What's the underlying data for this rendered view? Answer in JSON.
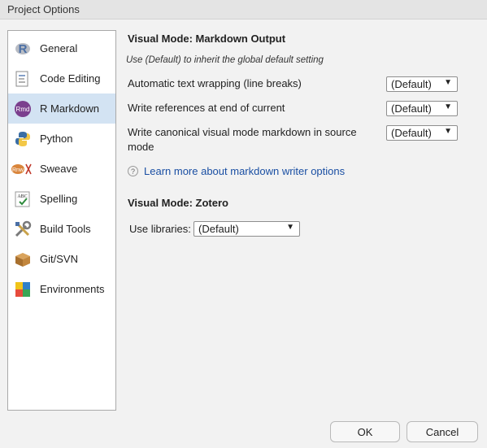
{
  "window": {
    "title": "Project Options"
  },
  "sidebar": {
    "items": [
      {
        "label": "General",
        "icon": "r-logo-icon"
      },
      {
        "label": "Code Editing",
        "icon": "code-editing-icon"
      },
      {
        "label": "R Markdown",
        "icon": "rmd-icon",
        "selected": true
      },
      {
        "label": "Python",
        "icon": "python-icon"
      },
      {
        "label": "Sweave",
        "icon": "sweave-icon"
      },
      {
        "label": "Spelling",
        "icon": "spelling-icon"
      },
      {
        "label": "Build Tools",
        "icon": "build-tools-icon"
      },
      {
        "label": "Git/SVN",
        "icon": "git-svn-icon"
      },
      {
        "label": "Environments",
        "icon": "environments-icon"
      }
    ]
  },
  "main": {
    "markdown_output_heading": "Visual Mode: Markdown Output",
    "inherit_note": "Use (Default) to inherit the global default setting",
    "options": [
      {
        "label": "Automatic text wrapping (line breaks)",
        "value": "(Default)"
      },
      {
        "label": "Write references at end of current",
        "value": "(Default)"
      },
      {
        "label": "Write canonical visual mode markdown in source mode",
        "value": "(Default)"
      }
    ],
    "help_link": "Learn more about markdown writer options",
    "zotero_heading": "Visual Mode: Zotero",
    "libraries_label": "Use libraries:",
    "libraries_value": "(Default)"
  },
  "footer": {
    "ok_label": "OK",
    "cancel_label": "Cancel"
  },
  "colors": {
    "selected_bg": "#d3e3f3",
    "link": "#1a4fa3",
    "window_bg": "#f2f2f2"
  }
}
